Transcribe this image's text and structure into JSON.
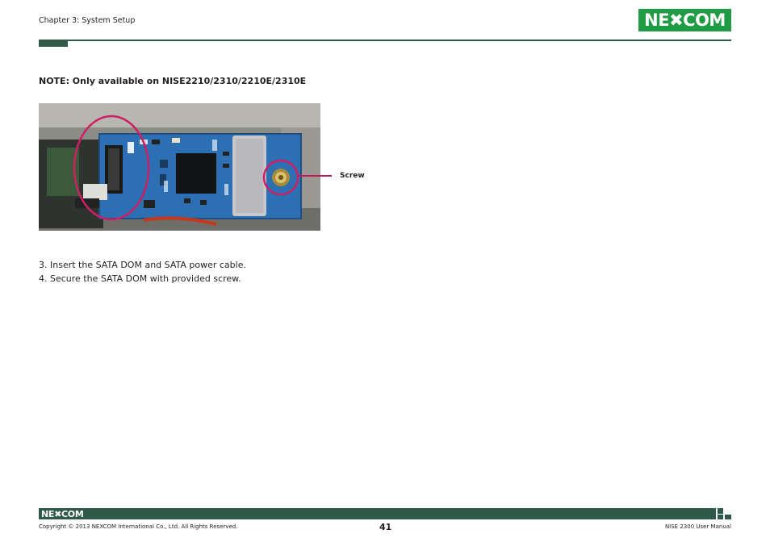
{
  "header": {
    "chapter": "Chapter 3: System Setup",
    "logo": "NE✖COM"
  },
  "content": {
    "note": "NOTE: Only available on NISE2210/2310/2210E/2310E",
    "callout_label": "Screw",
    "steps": [
      "3. Insert the SATA DOM and SATA power cable.",
      "4. Secure the SATA DOM with provided screw."
    ]
  },
  "footer": {
    "logo": "NE✖COM",
    "copyright": "Copyright © 2013 NEXCOM International Co., Ltd. All Rights Reserved.",
    "page_number": "41",
    "manual": "NISE 2300 User Manual"
  },
  "colors": {
    "brand_green": "#1f9a45",
    "rule_green": "#2f5a4a",
    "callout_magenta": "#c0185c"
  }
}
